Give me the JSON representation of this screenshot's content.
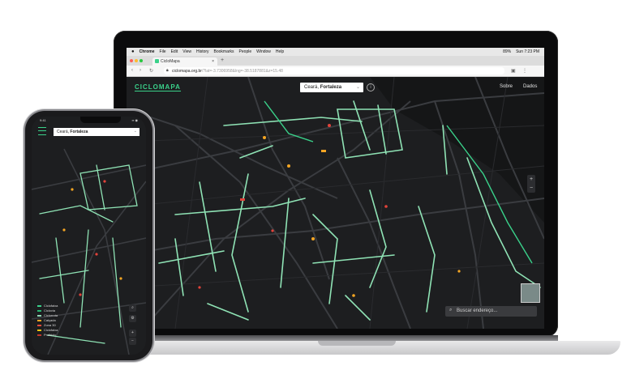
{
  "menubar": {
    "apple": "",
    "items": [
      "Chrome",
      "File",
      "Edit",
      "View",
      "History",
      "Bookmarks",
      "People",
      "Window",
      "Help"
    ],
    "battery": "89%",
    "clock": "Sun 7:23 PM"
  },
  "browser": {
    "tab_title": "CicloMapa",
    "tab_close": "×",
    "new_tab": "+",
    "url_host": "ciclomapa.org.br",
    "url_rest": "/?lat=-3.7306958&lng=-38.5187881&z=15.48"
  },
  "app": {
    "logo": "CICLOMAPA",
    "city_state": "Ceará,",
    "city_name": "Fortaleza",
    "info": "i",
    "nav": {
      "about": "Sobre",
      "data": "Dados"
    },
    "zoom_in": "+",
    "zoom_out": "−",
    "search_placeholder": "Buscar endereço..."
  },
  "phone": {
    "time": "9:41",
    "status_right": "▪▪ ◉",
    "city_state": "Ceará,",
    "city_name": "Fortaleza",
    "legend": [
      {
        "label": "Ciclofaixa",
        "color": "#3ad18a"
      },
      {
        "label": "Ciclovia",
        "color": "#2bb673"
      },
      {
        "label": "Ciclorrota",
        "color": "#8fd9b6"
      },
      {
        "label": "Calçada",
        "color": "#f5a623"
      },
      {
        "label": "Zona 30",
        "color": "#e74c3c"
      },
      {
        "label": "Ciclofaixa",
        "color": "#f1c40f"
      },
      {
        "label": "Proibido",
        "color": "#c0392b"
      }
    ],
    "controls": {
      "search": "⌕",
      "settings": "⚙",
      "zoom_in": "+",
      "zoom_out": "−"
    }
  },
  "colors": {
    "accent": "#3ad18a",
    "map_bg": "#1d1e20",
    "road": "#3a3c40",
    "bike_lane": "#8fe3b5",
    "point_orange": "#f5a623",
    "point_red": "#e2433a"
  }
}
